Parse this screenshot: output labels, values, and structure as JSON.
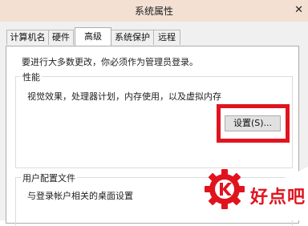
{
  "window": {
    "title": "系统属性",
    "close_glyph": "✕"
  },
  "tabs": [
    {
      "label": "计算机名"
    },
    {
      "label": "硬件"
    },
    {
      "label": "高级"
    },
    {
      "label": "系统保护"
    },
    {
      "label": "远程"
    }
  ],
  "active_tab": "高级",
  "notice": "要进行大多数更改，你必须作为管理员登录。",
  "performance": {
    "title": "性能",
    "description": "视觉效果，处理器计划，内存使用，以及虚拟内存",
    "settings_button": "设置(S)..."
  },
  "user_profiles": {
    "title": "用户配置文件",
    "description": "与登录帐户相关的桌面设置"
  },
  "watermark": {
    "text": "好点吧",
    "color": "#e0141e"
  },
  "colors": {
    "highlight": "#e0141e",
    "titlebar": "#f3e0d3",
    "dialog_bg": "#f0f0f0"
  }
}
